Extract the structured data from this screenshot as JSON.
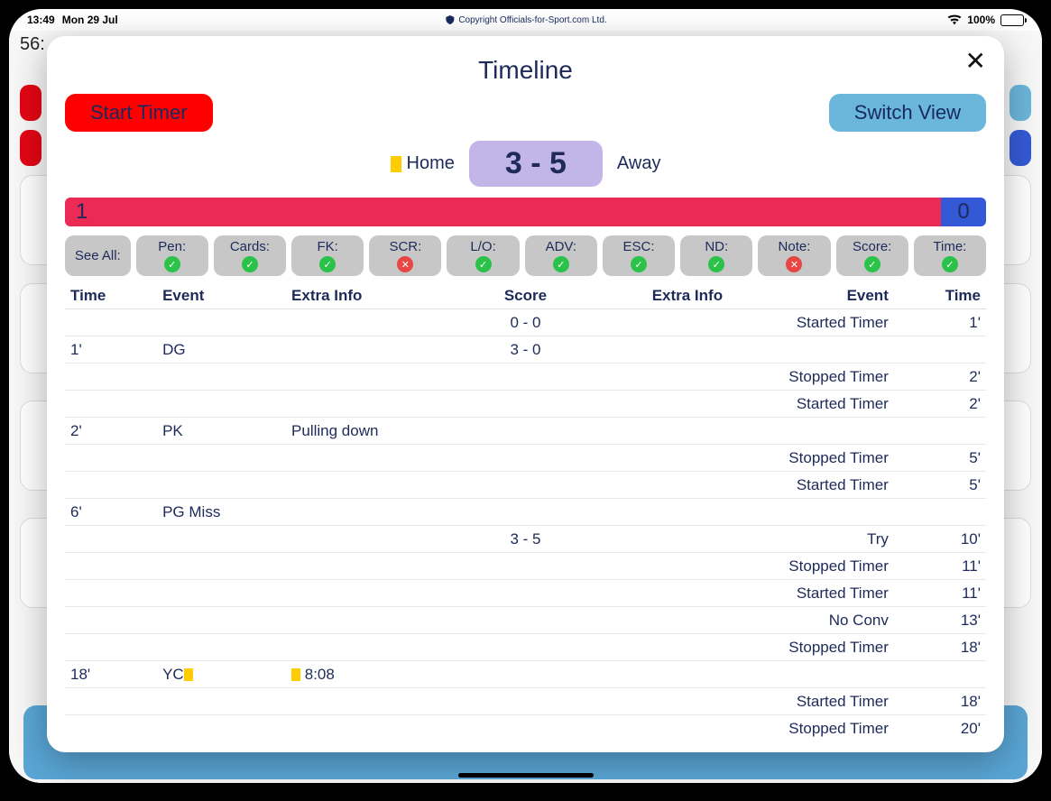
{
  "status": {
    "time": "13:49",
    "date": "Mon 29 Jul",
    "copyright": "Copyright Officials-for-Sport.com Ltd.",
    "battery_pct": "100%"
  },
  "bg": {
    "timer": "56:"
  },
  "modal": {
    "title": "Timeline",
    "start_timer": "Start Timer",
    "switch_view": "Switch View",
    "home_label": "Home",
    "away_label": "Away",
    "score": "3 - 5",
    "period_left": "1",
    "period_right": "0"
  },
  "filters": {
    "see_all": "See All:",
    "items": [
      {
        "label": "Pen:",
        "ok": true
      },
      {
        "label": "Cards:",
        "ok": true
      },
      {
        "label": "FK:",
        "ok": true
      },
      {
        "label": "SCR:",
        "ok": false
      },
      {
        "label": "L/O:",
        "ok": true
      },
      {
        "label": "ADV:",
        "ok": true
      },
      {
        "label": "ESC:",
        "ok": true
      },
      {
        "label": "ND:",
        "ok": true
      },
      {
        "label": "Note:",
        "ok": false
      },
      {
        "label": "Score:",
        "ok": true
      },
      {
        "label": "Time:",
        "ok": true
      }
    ]
  },
  "headers": {
    "h1": "Time",
    "h2": "Event",
    "h3": "Extra Info",
    "h4": "Score",
    "h5": "Extra Info",
    "h6": "Event",
    "h7": "Time"
  },
  "rows": [
    {
      "t1": "",
      "ev1": "",
      "ex1": "",
      "sc": "0 - 0",
      "ex2": "",
      "ev2": "Started Timer",
      "t2": "1'"
    },
    {
      "t1": "1'",
      "ev1": "DG",
      "ex1": "",
      "sc": "3 - 0",
      "ex2": "",
      "ev2": "",
      "t2": ""
    },
    {
      "t1": "",
      "ev1": "",
      "ex1": "",
      "sc": "",
      "ex2": "",
      "ev2": "Stopped Timer",
      "t2": "2'"
    },
    {
      "t1": "",
      "ev1": "",
      "ex1": "",
      "sc": "",
      "ex2": "",
      "ev2": "Started Timer",
      "t2": "2'"
    },
    {
      "t1": "2'",
      "ev1": "PK",
      "ex1": "Pulling down",
      "sc": "",
      "ex2": "",
      "ev2": "",
      "t2": ""
    },
    {
      "t1": "",
      "ev1": "",
      "ex1": "",
      "sc": "",
      "ex2": "",
      "ev2": "Stopped Timer",
      "t2": "5'"
    },
    {
      "t1": "",
      "ev1": "",
      "ex1": "",
      "sc": "",
      "ex2": "",
      "ev2": "Started Timer",
      "t2": "5'"
    },
    {
      "t1": "6'",
      "ev1": "PG Miss",
      "ex1": "",
      "sc": "",
      "ex2": "",
      "ev2": "",
      "t2": ""
    },
    {
      "t1": "",
      "ev1": "",
      "ex1": "",
      "sc": "3 - 5",
      "ex2": "",
      "ev2": "Try",
      "t2": "10'"
    },
    {
      "t1": "",
      "ev1": "",
      "ex1": "",
      "sc": "",
      "ex2": "",
      "ev2": "Stopped Timer",
      "t2": "11'"
    },
    {
      "t1": "",
      "ev1": "",
      "ex1": "",
      "sc": "",
      "ex2": "",
      "ev2": "Started Timer",
      "t2": "11'"
    },
    {
      "t1": "",
      "ev1": "",
      "ex1": "",
      "sc": "",
      "ex2": "",
      "ev2": "No Conv",
      "t2": "13'"
    },
    {
      "t1": "",
      "ev1": "",
      "ex1": "",
      "sc": "",
      "ex2": "",
      "ev2": "Stopped Timer",
      "t2": "18'"
    },
    {
      "t1": "18'",
      "ev1": "YC",
      "ex1": "8:08",
      "sc": "",
      "ex2": "",
      "ev2": "",
      "t2": "",
      "yc": true,
      "ex_badge": true
    },
    {
      "t1": "",
      "ev1": "",
      "ex1": "",
      "sc": "",
      "ex2": "",
      "ev2": "Started Timer",
      "t2": "18'"
    },
    {
      "t1": "",
      "ev1": "",
      "ex1": "",
      "sc": "",
      "ex2": "",
      "ev2": "Stopped Timer",
      "t2": "20'"
    }
  ]
}
